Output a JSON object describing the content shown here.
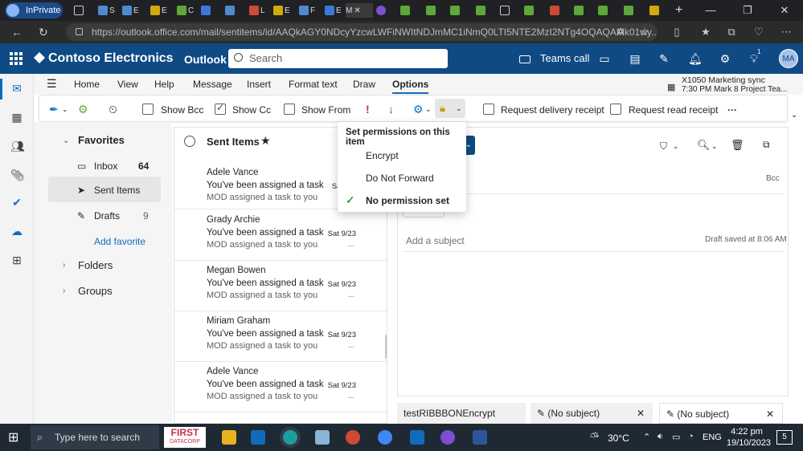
{
  "browser": {
    "inprivate_label": "InPrivate",
    "url": "https://outlook.office.com/mail/sentitems/id/AAQkAGY0NDcyYzcwLWFiNWItNDJmMC1iNmQ0LTI5NTE2MzI2NTg4OQAQAMk01wy...",
    "tabs_short": [
      "S",
      "E",
      "E",
      "C",
      "L",
      "E",
      "F",
      "E",
      "M"
    ],
    "tab_colors": [
      "#4f8ad1",
      "#4f8ad1",
      "#d4a80f",
      "#5da83a",
      "#d04a33",
      "#3c78d8",
      "#d04a33",
      "#3c78d8",
      "#7c4fd1",
      "#3c78d8",
      "#2f2f2f"
    ]
  },
  "outlook": {
    "brand": "Contoso Electronics",
    "app_name": "Outlook",
    "search_placeholder": "Search",
    "teams_call": "Teams call",
    "notification_count": "1",
    "avatar_initials": "MA"
  },
  "ribbon": {
    "tabs": [
      "Home",
      "View",
      "Help",
      "Message",
      "Insert",
      "Format text",
      "Draw",
      "Options"
    ],
    "active_tab": "Options",
    "meeting_title": "X1050 Marketing sync",
    "meeting_time": "7:30 PM Mark 8 Project Tea...",
    "show_bcc": "Show Bcc",
    "show_cc": "Show Cc",
    "show_from": "Show From",
    "request_delivery": "Request delivery receipt",
    "request_read": "Request read receipt",
    "more": "···"
  },
  "folders": {
    "favorites": "Favorites",
    "inbox": "Inbox",
    "inbox_count": "64",
    "sent": "Sent Items",
    "drafts": "Drafts",
    "drafts_count": "9",
    "add_favorite": "Add favorite",
    "folders_label": "Folders",
    "groups_label": "Groups"
  },
  "message_list": {
    "title": "Sent Items",
    "messages": [
      {
        "sender": "Adele Vance",
        "subject": "You've been assigned a task",
        "preview": "MOD assigned a task to you",
        "date": "Sat",
        "ellipsis": ""
      },
      {
        "sender": "Grady Archie",
        "subject": "You've been assigned a task",
        "preview": "MOD assigned a task to you",
        "date": "Sat 9/23",
        "ellipsis": "..."
      },
      {
        "sender": "Megan Bowen",
        "subject": "You've been assigned a task",
        "preview": "MOD assigned a task to you",
        "date": "Sat 9/23",
        "ellipsis": "..."
      },
      {
        "sender": "Miriam Graham",
        "subject": "You've been assigned a task",
        "preview": "MOD assigned a task to you",
        "date": "Sat 9/23",
        "ellipsis": "..."
      },
      {
        "sender": "Adele Vance",
        "subject": "You've been assigned a task",
        "preview": "MOD assigned a task to you",
        "date": "Sat 9/23",
        "ellipsis": "..."
      }
    ]
  },
  "permissions_menu": {
    "title": "Set permissions on this item",
    "items": [
      "Encrypt",
      "Do Not Forward",
      "No permission set"
    ],
    "selected_index": 2
  },
  "compose": {
    "bcc": "Bcc",
    "subject_placeholder": "Add a subject",
    "draft_status": "Draft saved at 8:06 AM"
  },
  "bottom_tabs": {
    "tab1": "testRIBBBONEncrypt",
    "tab2": "(No subject)",
    "tab3": "(No subject)"
  },
  "taskbar": {
    "search_placeholder": "Type here to search",
    "first_brand_line1": "FIRST",
    "first_brand_line2": "DATACORP",
    "temperature": "30°C",
    "language": "ENG",
    "time": "4:22 pm",
    "date": "19/10/2023",
    "notifications": "5"
  }
}
